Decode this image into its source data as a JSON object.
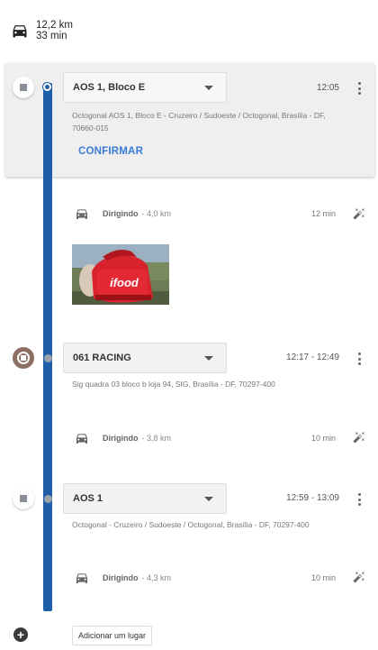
{
  "summary": {
    "distance": "12,2 km",
    "duration": "33 min",
    "icon": "car-icon"
  },
  "stops": [
    {
      "name": "AOS 1, Bloco E",
      "time": "12:05",
      "address_line1": "Octogonal AOS 1, Bloco E - Cruzeiro / Sudoeste / Octogonal, Brasília - DF,",
      "address_line2": "70660-015",
      "confirm_label": "CONFIRMAR"
    },
    {
      "name": "061 RACING",
      "time": "12:17 - 12:49",
      "address_line1": "Sig quadra 03 bloco b loja 94, SIG, Brasília - DF, 70297-400"
    },
    {
      "name": "AOS 1",
      "time": "12:59 - 13:09",
      "address_line1": "Octogonal - Cruzeiro / Sudoeste / Octogonal, Brasília - DF, 70297-400"
    }
  ],
  "legs": [
    {
      "mode": "Dirigindo",
      "distance": "- 4,0 km",
      "duration": "12 min"
    },
    {
      "mode": "Dirigindo",
      "distance": "- 3,8 km",
      "duration": "10 min"
    },
    {
      "mode": "Dirigindo",
      "distance": "- 4,3 km",
      "duration": "10 min"
    }
  ],
  "photo": {
    "brand_text": "ifood"
  },
  "add_place_label": "Adicionar um lugar",
  "colors": {
    "route": "#1f5ea8",
    "confirm": "#3a7bd5",
    "active_marker": "#8d6e63",
    "ifood_red": "#e0202a"
  }
}
